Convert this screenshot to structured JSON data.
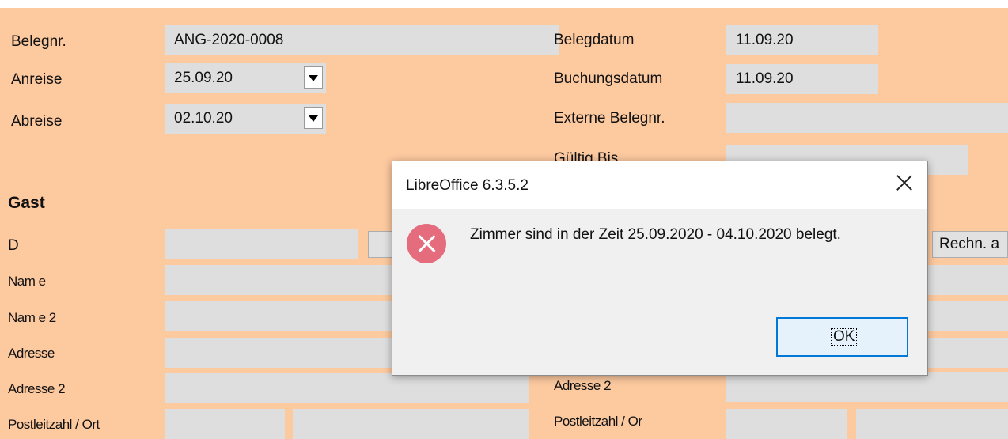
{
  "form": {
    "belegnr_label": "Belegnr.",
    "belegnr_value": "ANG-2020-0008",
    "anreise_label": "Anreise",
    "anreise_value": "25.09.20",
    "abreise_label": "Abreise",
    "abreise_value": "02.10.20",
    "belegdatum_label": "Belegdatum",
    "belegdatum_value": "11.09.20",
    "buchungsdatum_label": "Buchungsdatum",
    "buchungsdatum_value": "11.09.20",
    "externe_label": "Externe Belegnr.",
    "externe_value": "",
    "gueltig_label": "Gültig Bis",
    "gueltig_value": ""
  },
  "gast": {
    "heading": "Gast",
    "id_label": "D",
    "name_label": "Nam e",
    "name2_label": "Nam e 2",
    "adresse_label": "Adresse",
    "adresse2_label": "Adresse 2",
    "plz_label": "Postleitzahl / Ort"
  },
  "right": {
    "rechn_button": "Rechn. a",
    "adresse2_label": "Adresse 2",
    "plz_label": "Postleitzahl / Or"
  },
  "dialog": {
    "title": "LibreOffice 6.3.5.2",
    "message": "Zimmer sind in der Zeit 25.09.2020 - 04.10.2020 belegt.",
    "ok_label": "OK",
    "icon": "error-icon"
  }
}
